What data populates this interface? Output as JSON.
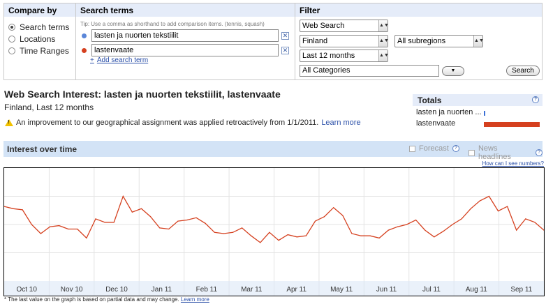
{
  "compare": {
    "header": "Compare by",
    "options": [
      {
        "label": "Search terms",
        "selected": true
      },
      {
        "label": "Locations",
        "selected": false
      },
      {
        "label": "Time Ranges",
        "selected": false
      }
    ]
  },
  "search_terms": {
    "header": "Search terms",
    "tip": "Tip: Use a comma as shorthand to add comparison items. (tennis, squash)",
    "terms": [
      {
        "value": "lasten ja nuorten tekstiilit",
        "color": "#5a86d8"
      },
      {
        "value": "lastenvaate",
        "color": "#d5401f"
      }
    ],
    "add_label": "Add search term"
  },
  "filter": {
    "header": "Filter",
    "property": "Web Search",
    "country": "Finland",
    "subregion": "All subregions",
    "time": "Last 12 months",
    "category": "All Categories",
    "search_button": "Search"
  },
  "results": {
    "title": "Web Search Interest: lasten ja nuorten tekstiilit, lastenvaate",
    "subtitle": "Finland, Last 12 months",
    "notice": "An improvement to our geographical assignment was applied retroactively from 1/1/2011.",
    "notice_link": "Learn more"
  },
  "totals": {
    "header": "Totals",
    "rows": [
      {
        "label": "lasten ja nuorten ...",
        "value": 1,
        "color": "#3a6fd6"
      },
      {
        "label": "lastenvaate",
        "value": 100,
        "color": "#d5401f"
      }
    ]
  },
  "interest": {
    "title": "Interest over time",
    "forecast": "Forecast",
    "headlines": "News headlines",
    "how_link": "How can I see numbers?",
    "footnote": "* The last value on the graph is based on partial data and may change.",
    "footnote_link": "Learn more"
  },
  "chart_data": {
    "type": "line",
    "x": [
      "Oct 10",
      "Nov 10",
      "Dec 10",
      "Jan 11",
      "Feb 11",
      "Mar 11",
      "Apr 11",
      "May 11",
      "Jun 11",
      "Jul 11",
      "Aug 11",
      "Sep 11"
    ],
    "series": [
      {
        "name": "lastenvaate",
        "color": "#d5401f",
        "values": [
          66,
          64,
          63,
          50,
          42,
          48,
          49,
          46,
          46,
          38,
          55,
          52,
          52,
          75,
          61,
          64,
          57,
          47,
          46,
          53,
          54,
          56,
          51,
          43,
          42,
          43,
          47,
          40,
          34,
          43,
          36,
          41,
          39,
          40,
          53,
          57,
          65,
          58,
          42,
          40,
          40,
          38,
          45,
          48,
          50,
          54,
          45,
          39,
          44,
          50,
          55,
          64,
          71,
          75,
          62,
          66,
          45,
          55,
          52,
          45
        ]
      }
    ],
    "ylim": [
      0,
      100
    ],
    "grid": true
  }
}
